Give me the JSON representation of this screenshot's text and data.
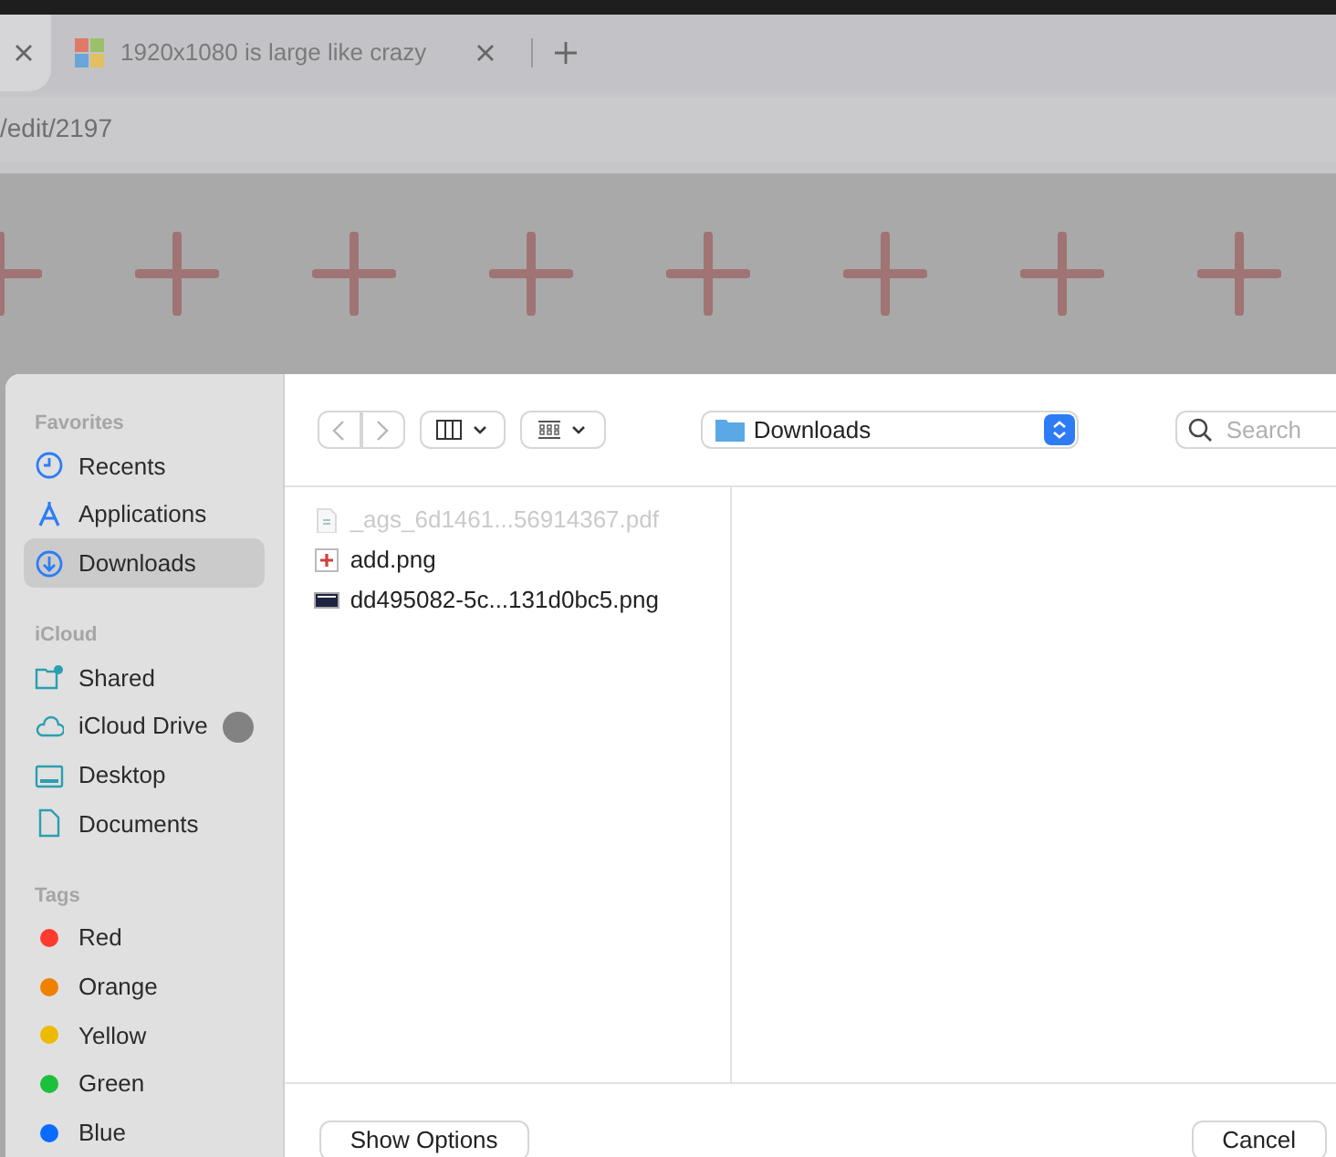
{
  "browser": {
    "tabs": [
      {
        "selected": true
      },
      {
        "title": "1920x1080 is large like crazy",
        "selected": false
      }
    ],
    "address": "/edit/2197"
  },
  "dialog": {
    "toolbar": {
      "location": "Downloads",
      "search": {
        "placeholder": "Search"
      }
    },
    "sidebar": [
      {
        "heading": "Favorites",
        "items": [
          {
            "label": "Recents",
            "selected": false
          },
          {
            "label": "Applications",
            "selected": false
          },
          {
            "label": "Downloads",
            "selected": true
          }
        ]
      },
      {
        "heading": "iCloud",
        "items": [
          {
            "label": "Shared",
            "selected": false
          },
          {
            "label": "iCloud Drive",
            "selected": false
          },
          {
            "label": "Desktop",
            "selected": false
          },
          {
            "label": "Documents",
            "selected": false
          }
        ]
      },
      {
        "heading": "Tags",
        "items": [
          {
            "label": "Red",
            "color": "#ff3b30"
          },
          {
            "label": "Orange",
            "color": "#f08000"
          },
          {
            "label": "Yellow",
            "color": "#ecbb00"
          },
          {
            "label": "Green",
            "color": "#1ebf3a"
          },
          {
            "label": "Blue",
            "color": "#0a6cff"
          }
        ]
      }
    ],
    "files": [
      {
        "name": "_ags_6d1461...56914367.pdf",
        "disabled": true
      },
      {
        "name": "add.png",
        "disabled": false
      },
      {
        "name": "dd495082-5c...131d0bc5.png",
        "disabled": false
      }
    ],
    "buttons": [
      "Show Options",
      "Cancel"
    ]
  }
}
